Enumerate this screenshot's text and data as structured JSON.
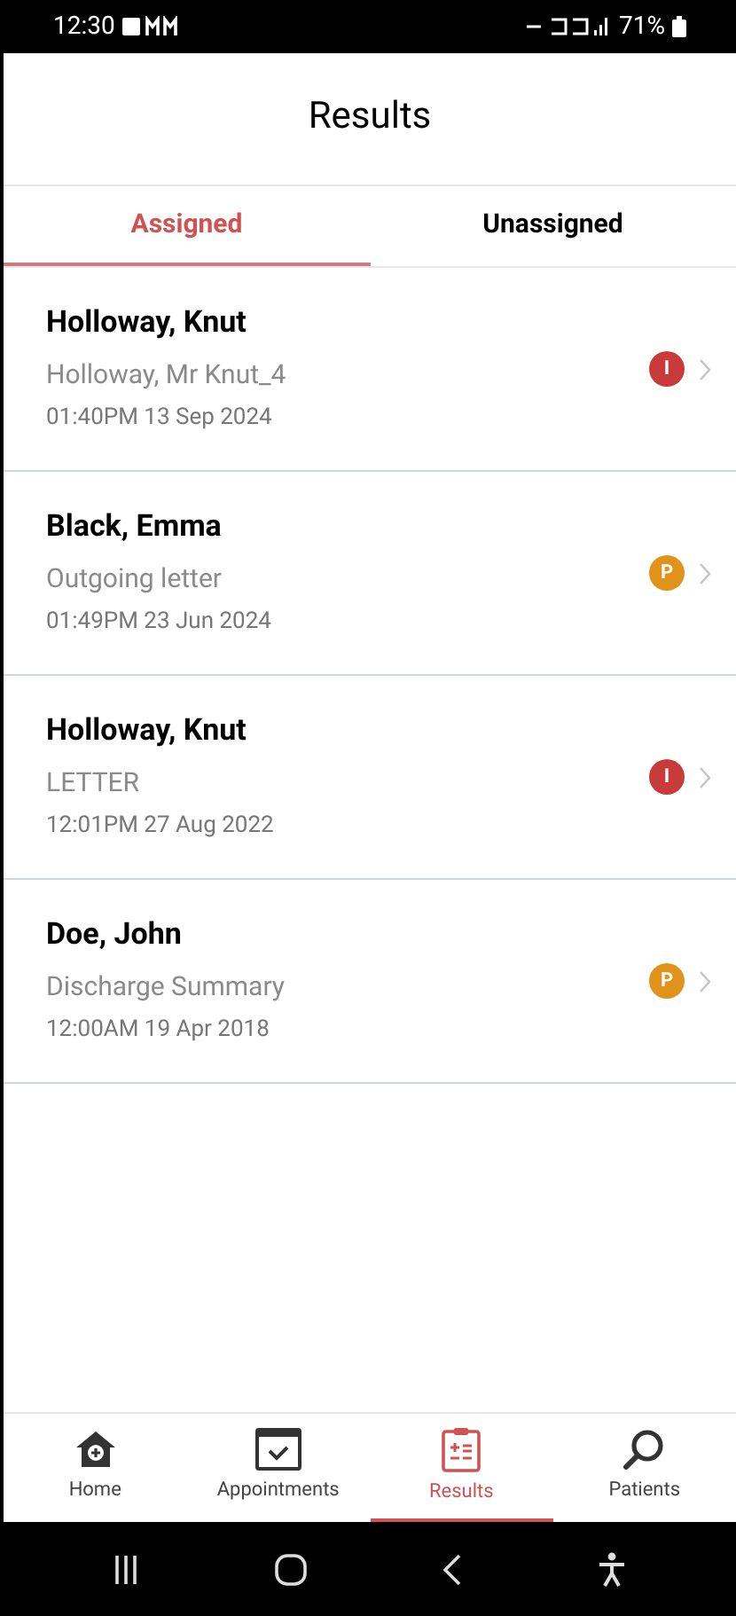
{
  "status_bar": {
    "time": "12:30",
    "battery": "71%"
  },
  "header": {
    "title": "Results"
  },
  "tabs": [
    {
      "label": "Assigned",
      "selected": true
    },
    {
      "label": "Unassigned",
      "selected": false
    }
  ],
  "results": [
    {
      "name": "Holloway, Knut",
      "description": "Holloway, Mr Knut_4",
      "datetime": "01:40PM 13 Sep 2024",
      "badge": "I",
      "color": "#c93a3a"
    },
    {
      "name": "Black, Emma",
      "description": "Outgoing letter",
      "datetime": "01:49PM 23 Jun 2024",
      "badge": "P",
      "color": "#e0921a"
    },
    {
      "name": "Holloway, Knut",
      "description": "LETTER",
      "datetime": "12:01PM 27 Aug 2022",
      "badge": "I",
      "color": "#c93a3a"
    },
    {
      "name": "Doe, John",
      "description": "Discharge Summary",
      "datetime": "12:00AM 19 Apr 2018",
      "badge": "P",
      "color": "#e0921a"
    }
  ],
  "bottom_nav": [
    {
      "kind": "home",
      "label": "Home",
      "selected": false
    },
    {
      "kind": "calendar",
      "label": "Appointments",
      "selected": false
    },
    {
      "kind": "clipboard",
      "label": "Results",
      "selected": true
    },
    {
      "kind": "search",
      "label": "Patients",
      "selected": false
    }
  ]
}
